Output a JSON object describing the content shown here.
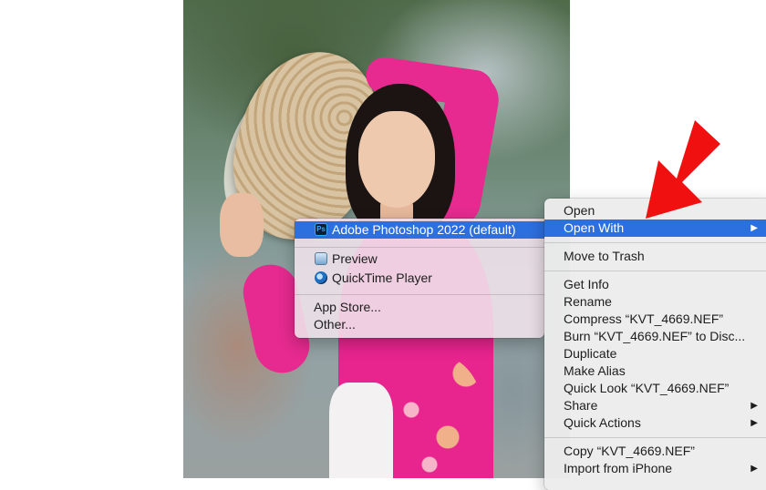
{
  "context_menu": {
    "items": [
      {
        "label": "Open"
      },
      {
        "label": "Open With",
        "highlighted": true,
        "has_submenu": true
      },
      {
        "label": "Move to Trash"
      },
      {
        "label": "Get Info"
      },
      {
        "label": "Rename"
      },
      {
        "label": "Compress “KVT_4669.NEF”"
      },
      {
        "label": "Burn “KVT_4669.NEF” to Disc..."
      },
      {
        "label": "Duplicate"
      },
      {
        "label": "Make Alias"
      },
      {
        "label": "Quick Look “KVT_4669.NEF”"
      },
      {
        "label": "Share",
        "has_submenu": true
      },
      {
        "label": "Quick Actions",
        "has_submenu": true
      },
      {
        "label": "Copy “KVT_4669.NEF”"
      },
      {
        "label": "Import from iPhone",
        "has_submenu": true
      }
    ],
    "submenu_arrow": "▶"
  },
  "open_with_submenu": {
    "items": [
      {
        "label": "Adobe Photoshop 2022 (default)",
        "icon": "photoshop-icon",
        "highlighted": true
      },
      {
        "label": "Preview",
        "icon": "preview-icon"
      },
      {
        "label": "QuickTime Player",
        "icon": "quicktime-icon"
      },
      {
        "label": "App Store..."
      },
      {
        "label": "Other..."
      }
    ],
    "ps_icon_text": "Ps"
  },
  "colors": {
    "highlight": "#2c6fde",
    "annotation_arrow": "#f01010"
  }
}
